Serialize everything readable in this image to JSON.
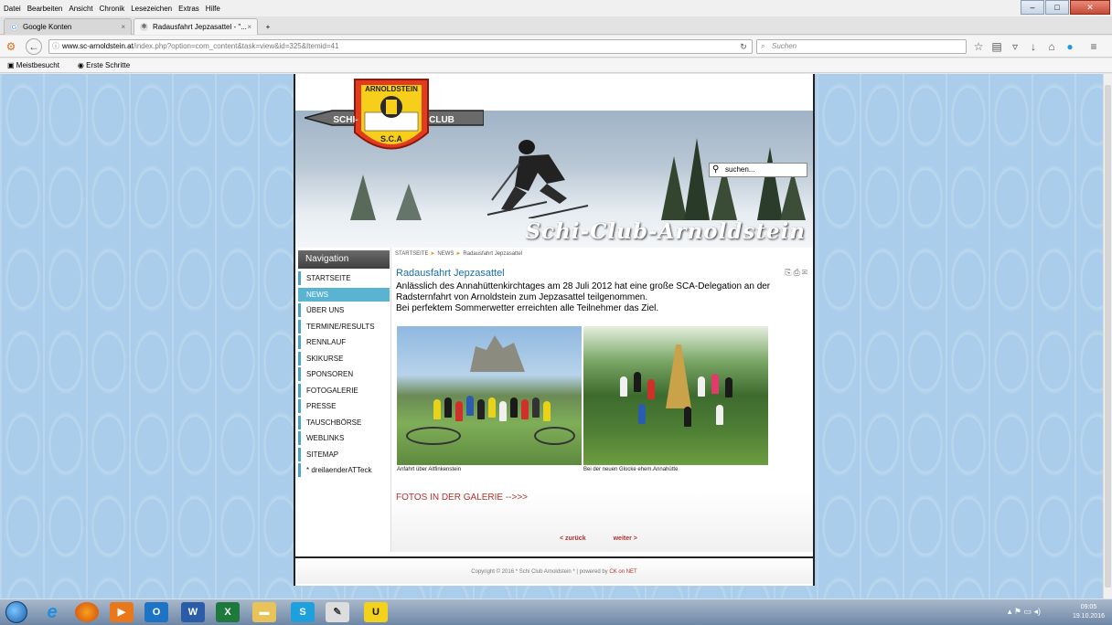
{
  "browser": {
    "menu": [
      "Datei",
      "Bearbeiten",
      "Ansicht",
      "Chronik",
      "Lesezeichen",
      "Extras",
      "Hilfe"
    ],
    "tabs": [
      {
        "label": "Google Konten",
        "active": false
      },
      {
        "label": "Radausfahrt Jepzasattel - \"...",
        "active": true
      }
    ],
    "url_host": "www.sc-arnoldstein.at",
    "url_path": "/index.php?option=com_content&task=view&id=325&Itemid=41",
    "search_placeholder": "Suchen",
    "bookmarks": [
      "Meistbesucht",
      "Erste Schritte"
    ]
  },
  "site": {
    "logo_top": "ARNOLDSTEIN",
    "logo_left": "SCHI-",
    "logo_right": "CLUB",
    "logo_bottom": "S.C.A",
    "slogan": "Schi-Club-Arnoldstein",
    "search_placeholder": "suchen...",
    "nav": {
      "heading": "Navigation",
      "items": [
        "STARTSEITE",
        "NEWS",
        "ÜBER UNS",
        "TERMINE/RESULTS",
        "RENNLAUF",
        "SKIKURSE",
        "SPONSOREN",
        "FOTOGALERIE",
        "PRESSE",
        "TAUSCHBÖRSE",
        "WEBLINKS",
        "SITEMAP",
        "* dreilaenderATTeck"
      ],
      "active_index": 1
    },
    "breadcrumb": [
      "STARTSEITE",
      "NEWS",
      "Radausfahrt Jepzasattel"
    ],
    "article": {
      "title": "Radausfahrt Jepzasattel",
      "line1": "Anlässlich des Annahüttenkirchtages am 28 Juli 2012  hat eine große SCA-Delegation an der",
      "line2": "Radsternfahrt von Arnoldstein zum Jepzasattel teilgenommen.",
      "line3": "Bei perfektem Sommerwetter erreichten alle Teilnehmer das Ziel.",
      "caption1": "Anfahrt über Altfinkenstein",
      "caption2": "Bei der neuen Glocke ehem.Annahütte",
      "gallery_link": "FOTOS IN DER GALERIE -->>>",
      "prev": "< zurück",
      "next": "weiter >"
    },
    "footer_text": "Copyright © 2016 * Schi Club Arnoldstein * | powered by",
    "footer_link": "CK on NET"
  },
  "taskbar": {
    "time": "09:05",
    "date": "19.10.2016"
  },
  "colors": {
    "accent": "#4aa3c8",
    "link": "#b3302a",
    "title": "#1a6ea8"
  }
}
